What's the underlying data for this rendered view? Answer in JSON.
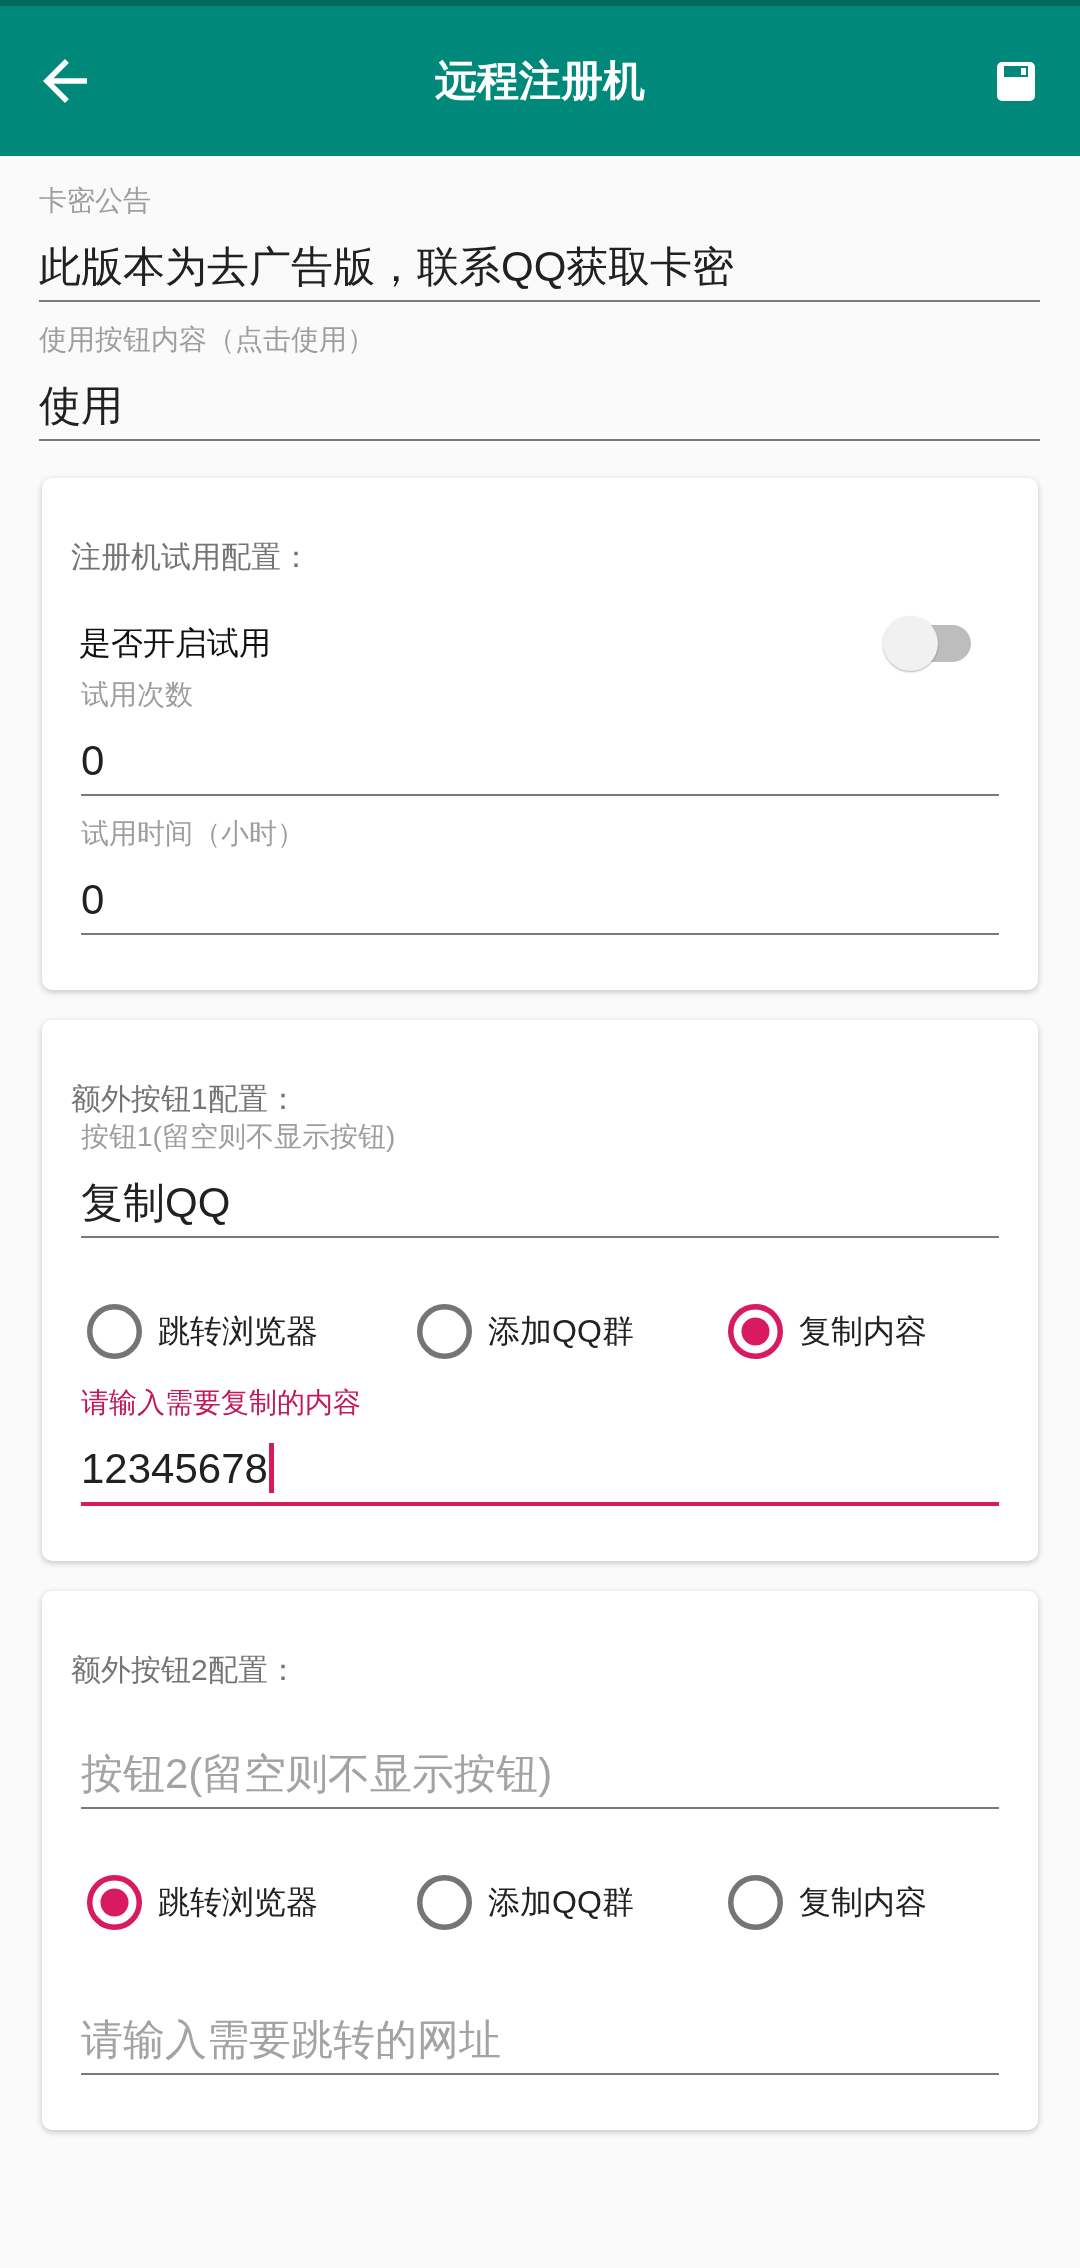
{
  "app_bar": {
    "title": "远程注册机"
  },
  "fields": [
    {
      "label": "卡密公告",
      "value": "此版本为去广告版，联系QQ获取卡密",
      "focused": false
    },
    {
      "label": "使用按钮内容（点击使用）",
      "value": "使用",
      "focused": false
    }
  ],
  "cards": [
    {
      "title": "注册机试用配置：",
      "items": [
        {
          "kind": "switch",
          "label": "是否开启试用",
          "on": false
        },
        {
          "kind": "field",
          "label": "试用次数",
          "value": "0",
          "focused": false
        },
        {
          "kind": "field",
          "label": "试用时间（小时）",
          "value": "0",
          "focused": false
        }
      ]
    },
    {
      "title": "额外按钮1配置：",
      "items": [
        {
          "kind": "field",
          "label": "按钮1(留空则不显示按钮)",
          "value": "复制QQ",
          "focused": false
        },
        {
          "kind": "radio_group",
          "options": [
            {
              "label": "跳转浏览器",
              "selected": false
            },
            {
              "label": "添加QQ群",
              "selected": false
            },
            {
              "label": "复制内容",
              "selected": true
            }
          ]
        },
        {
          "kind": "field",
          "label": "请输入需要复制的内容",
          "value": "12345678",
          "focused": true
        }
      ]
    },
    {
      "title": "额外按钮2配置：",
      "items": [
        {
          "kind": "field",
          "placeholder": "按钮2(留空则不显示按钮)",
          "focused": false
        },
        {
          "kind": "radio_group",
          "options": [
            {
              "label": "跳转浏览器",
              "selected": true
            },
            {
              "label": "添加QQ群",
              "selected": false
            },
            {
              "label": "复制内容",
              "selected": false
            }
          ]
        },
        {
          "kind": "field",
          "placeholder": "请输入需要跳转的网址",
          "focused": false
        }
      ]
    }
  ]
}
